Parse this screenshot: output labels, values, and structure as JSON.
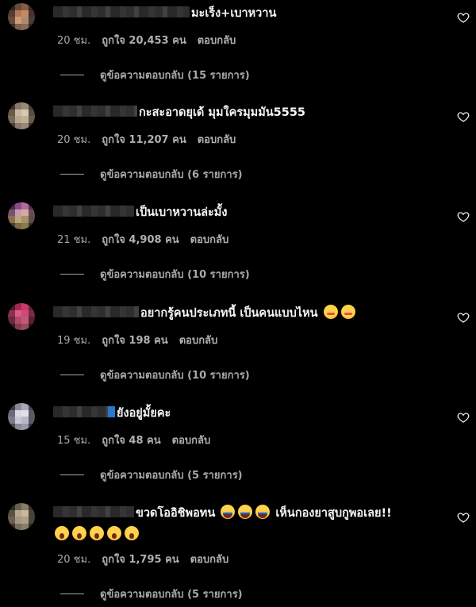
{
  "colors": {
    "background": "#000000",
    "text": "#f5f5f5",
    "secondary": "#a8a8a8"
  },
  "comments": [
    {
      "text": "มะเร็ง+เบาหวาน",
      "time": "20 ชม.",
      "likes": "ถูกใจ 20,453 คน",
      "reply": "ตอบกลับ",
      "view_replies": "ดูข้อความตอบกลับ (15 รายการ)",
      "avatar_colors": [
        "#2a2421",
        "#6b4a3c",
        "#8a5c47",
        "#3a2a24",
        "#5a3a30",
        "#b07a5a",
        "#c48a66",
        "#4a3028",
        "#6a4a3a",
        "#d09a78",
        "#b08a70",
        "#4a3a34",
        "#3a2e2a",
        "#7a6050",
        "#8a6a58",
        "#2e2624"
      ]
    },
    {
      "text": "กะสะอาดยุเด้ มุมใครมุมมัน5555",
      "time": "20 ชม.",
      "likes": "ถูกใจ 11,207 คน",
      "reply": "ตอบกลับ",
      "view_replies": "ดูข้อความตอบกลับ (6 รายการ)",
      "avatar_colors": [
        "#3a3430",
        "#8a7a6a",
        "#9a8a78",
        "#4a4038",
        "#6a5a4c",
        "#c8b8a0",
        "#d8c8b0",
        "#5a4c40",
        "#7a6a5a",
        "#b8a890",
        "#c0b098",
        "#6a5a4a",
        "#4a4038",
        "#8a7868",
        "#9a8878",
        "#3e3632"
      ]
    },
    {
      "text": "เป็นเบาหวานล่ะมั้ง",
      "time": "21 ชม.",
      "likes": "ถูกใจ 4,908 คน",
      "reply": "ตอบกลับ",
      "view_replies": "ดูข้อความตอบกลับ (10 รายการ)",
      "avatar_colors": [
        "#4a2a4a",
        "#8a4a8a",
        "#b06aa0",
        "#5a3050",
        "#7a5070",
        "#c89ab0",
        "#d8a8a0",
        "#6a4858",
        "#8a7050",
        "#b8a878",
        "#a8906a",
        "#5a5040",
        "#4a4030",
        "#7a6a48",
        "#8a7850",
        "#3a3428"
      ]
    },
    {
      "text": "อยากรู้คนประเภทนี้ เป็นคนแบบไหน",
      "emojis": [
        "flushed",
        "flushed"
      ],
      "time": "19 ชม.",
      "likes": "ถูกใจ 198 คน",
      "reply": "ตอบกลับ",
      "view_replies": "ดูข้อความตอบกลับ (10 รายการ)",
      "avatar_colors": [
        "#4a1a2a",
        "#a02a50",
        "#c83a68",
        "#6a2038",
        "#8a3050",
        "#e05a88",
        "#d04a78",
        "#7a2a44",
        "#6a2a3a",
        "#b04a68",
        "#c05a78",
        "#5a2030",
        "#3a1a24",
        "#8a3a50",
        "#9a4a60",
        "#2e1a20"
      ]
    },
    {
      "text": "ยังอยู่มั้ยคะ",
      "time": "15 ชม.",
      "likes": "ถูกใจ 48 คน",
      "reply": "ตอบกลับ",
      "view_replies": "ดูข้อความตอบกลับ (5 รายการ)",
      "avatar_colors": [
        "#3a3a44",
        "#8a8a98",
        "#a8a8b8",
        "#4a4a54",
        "#6a6a78",
        "#d8d8e4",
        "#e0e0ec",
        "#5a5a68",
        "#7a7a88",
        "#c8c8d4",
        "#b8b8c8",
        "#5a5a64",
        "#4a4a54",
        "#8a8a98",
        "#9a9aa8",
        "#3a3a44"
      ]
    },
    {
      "text": "ขวดโออิชิพอทน",
      "text_after": "เห็นกองยาสูบกูพอเลย!!",
      "emojis": [
        "laugh",
        "laugh",
        "laugh"
      ],
      "second_emojis": [
        "shock",
        "shock",
        "shock",
        "shock",
        "shock"
      ],
      "time": "20 ชม.",
      "likes": "ถูกใจ 1,795 คน",
      "reply": "ตอบกลับ",
      "view_replies": "ดูข้อความตอบกลับ (5 รายการ)",
      "avatar_colors": [
        "#2e2a26",
        "#6a6050",
        "#8a7a68",
        "#3a342e",
        "#5a5044",
        "#b8a890",
        "#c8b8a0",
        "#4a4238",
        "#6a6050",
        "#a89880",
        "#b0a088",
        "#4a4238",
        "#3a342e",
        "#7a6e5e",
        "#8a7e6c",
        "#2e2a26"
      ]
    }
  ]
}
